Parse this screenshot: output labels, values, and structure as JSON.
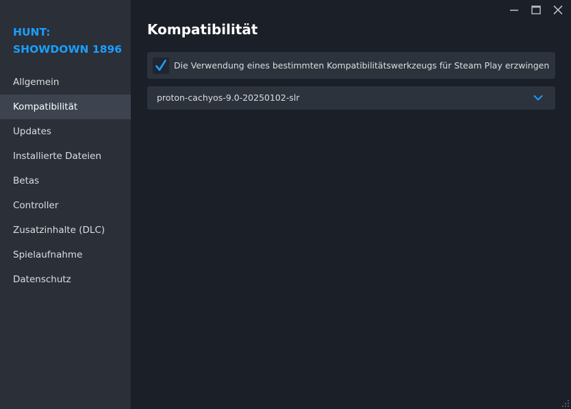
{
  "sidebar": {
    "game_title": "HUNT: SHOWDOWN 1896",
    "items": [
      {
        "label": "Allgemein"
      },
      {
        "label": "Kompatibilität"
      },
      {
        "label": "Updates"
      },
      {
        "label": "Installierte Dateien"
      },
      {
        "label": "Betas"
      },
      {
        "label": "Controller"
      },
      {
        "label": "Zusatzinhalte (DLC)"
      },
      {
        "label": "Spielaufnahme"
      },
      {
        "label": "Datenschutz"
      }
    ],
    "active_index": 1
  },
  "main": {
    "title": "Kompatibilität",
    "force_tool_checkbox": {
      "checked": true,
      "label": "Die Verwendung eines bestimmten Kompatibilitätswerkzeugs für Steam Play erzwingen"
    },
    "tool_select": {
      "value": "proton-cachyos-9.0-20250102-slr"
    }
  },
  "window_controls": {
    "icons": [
      "minimize-icon",
      "maximize-icon",
      "close-icon"
    ]
  },
  "colors": {
    "accent": "#1a9fff",
    "sidebar_bg": "#2b2f38",
    "main_bg": "#1b1f27",
    "active_item_bg": "#3d4450",
    "control_bg": "#2d333d"
  }
}
